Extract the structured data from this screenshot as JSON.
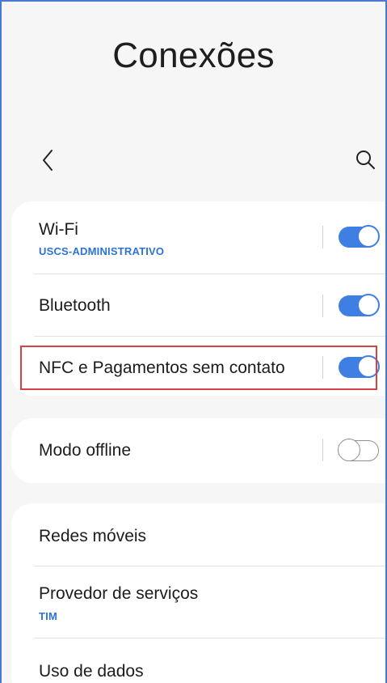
{
  "page": {
    "title": "Conexões"
  },
  "toolbar": {
    "back_icon": "chevron-left-icon",
    "search_icon": "search-icon"
  },
  "colors": {
    "accent": "#3f7fe4",
    "highlight": "#d94040",
    "sublabel": "#2b73d6"
  },
  "settings": {
    "wifi": {
      "label": "Wi-Fi",
      "sublabel": "USCS-ADMINISTRATIVO",
      "enabled": true
    },
    "bluetooth": {
      "label": "Bluetooth",
      "enabled": true
    },
    "nfc": {
      "label": "NFC e Pagamentos sem contato",
      "enabled": true,
      "highlighted": true
    },
    "airplane": {
      "label": "Modo offline",
      "enabled": false
    },
    "mobile_networks": {
      "label": "Redes móveis"
    },
    "service_provider": {
      "label": "Provedor de serviços",
      "sublabel": "TIM"
    },
    "data_usage": {
      "label": "Uso de dados"
    }
  }
}
